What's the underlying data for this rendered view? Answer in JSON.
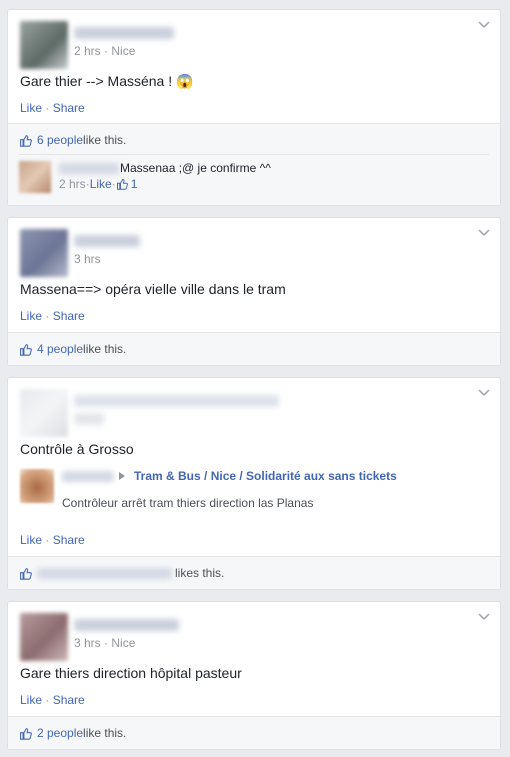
{
  "posts": [
    {
      "meta_time": "2 hrs",
      "meta_sep": " · ",
      "meta_place": "Nice",
      "text": "Gare thier --> Masséna ! 😱",
      "like_label": "Like",
      "share_label": "Share",
      "dot": " · ",
      "likes_link": "6 people",
      "likes_suffix": " like this.",
      "comment": {
        "text": "Massenaa ;@ je confirme ^^",
        "time": "2 hrs",
        "dot": " · ",
        "like_label": "Like",
        "like_count": "1"
      }
    },
    {
      "meta_time": "3 hrs",
      "text": "Massena==> opéra vielle ville dans le tram",
      "like_label": "Like",
      "share_label": "Share",
      "dot": " · ",
      "likes_link": "4 people",
      "likes_suffix": " like this."
    },
    {
      "text": "Contrôle à Grosso",
      "shared_group": "Tram & Bus / Nice / Solidarité aux sans tickets",
      "shared_text": "Contrôleur arrêt tram thiers direction las Planas",
      "like_label": "Like",
      "share_label": "Share",
      "dot": " · ",
      "likes_suffix": "likes this."
    },
    {
      "meta_time": "3 hrs",
      "meta_sep": " · ",
      "meta_place": "Nice",
      "text": "Gare thiers direction hôpital pasteur",
      "like_label": "Like",
      "share_label": "Share",
      "dot": " · ",
      "likes_link": "2 people",
      "likes_suffix": " like this."
    }
  ],
  "colors": {
    "link": "#4267b2",
    "meta": "#90949c",
    "background": "#e9ebee"
  },
  "icons": {
    "chevron": "chevron-down-icon",
    "thumb": "thumbs-up-icon",
    "arrow": "caret-right-icon"
  }
}
